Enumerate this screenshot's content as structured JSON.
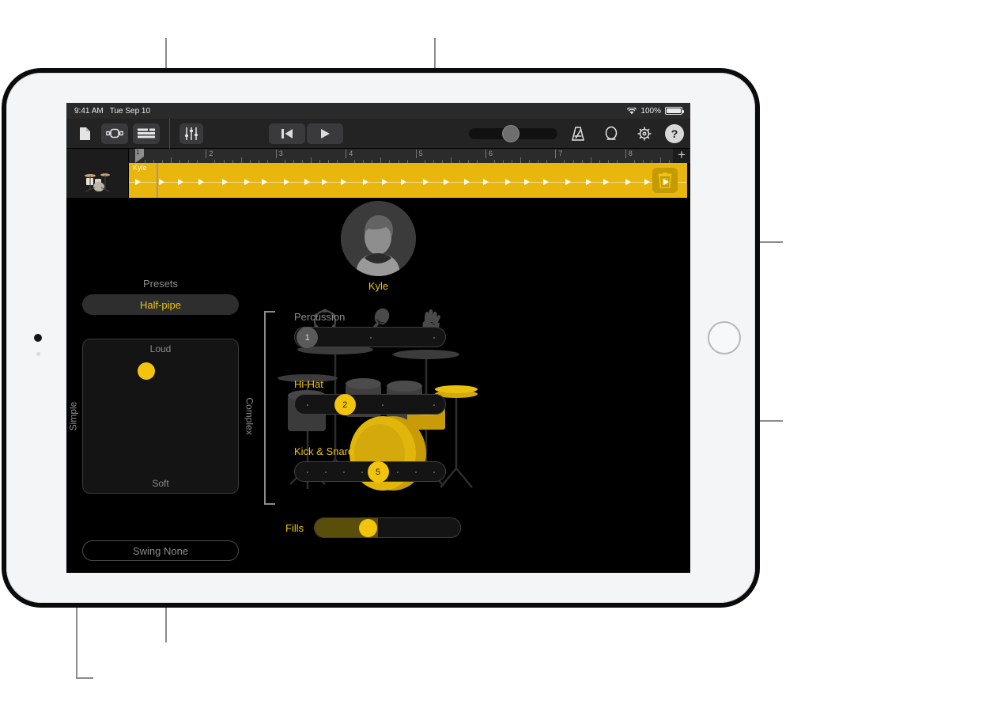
{
  "status_bar": {
    "time": "9:41 AM",
    "date": "Tue Sep 10",
    "battery_percent": "100%",
    "wifi_icon": "wifi-icon",
    "battery_icon": "battery-icon"
  },
  "toolbar": {
    "items": [
      {
        "name": "document-icon",
        "label": ""
      },
      {
        "name": "loop-browser-icon",
        "label": ""
      },
      {
        "name": "track-view-icon",
        "label": ""
      },
      {
        "name": "mixer-icon",
        "label": ""
      }
    ],
    "transport": {
      "rewind_label": "rewind-to-start-icon",
      "play_label": "play-icon"
    },
    "master_volume": {
      "name": "master-volume-slider",
      "value": 40
    },
    "right_icons": [
      {
        "name": "metronome-icon"
      },
      {
        "name": "loop-cycle-icon"
      },
      {
        "name": "settings-gear-icon"
      }
    ],
    "help_label": "?"
  },
  "ruler": {
    "bars": [
      "1",
      "2",
      "3",
      "4",
      "5",
      "6",
      "7",
      "8"
    ],
    "playhead_bar": "1",
    "add_track_label": "+"
  },
  "track": {
    "instrument_icon": "drum-kit-icon",
    "region_name": "Kyle",
    "delete_label": "trash-icon",
    "region_color": "#e8b60d"
  },
  "drummer": {
    "presets_label": "Presets",
    "preset_value": "Half-pipe",
    "swing_value": "Swing None",
    "xy_pad": {
      "top_label": "Loud",
      "bottom_label": "Soft",
      "left_label": "Simple",
      "right_label": "Complex",
      "puck_name": "xy-pad-puck"
    },
    "avatar": {
      "name": "Kyle",
      "image_name": "drummer-avatar"
    },
    "percussion_icons": [
      {
        "name": "tambourine-icon"
      },
      {
        "name": "shaker-icon"
      },
      {
        "name": "hand-clap-icon"
      }
    ],
    "fills": {
      "label": "Fills",
      "value": 30
    },
    "sliders": [
      {
        "name": "percussion-slider",
        "label": "Percussion",
        "value": "1",
        "active": false,
        "position_percent": 8,
        "dots": [
          50,
          92
        ]
      },
      {
        "name": "hi-hat-slider",
        "label": "Hi-Hat",
        "value": "2",
        "active": true,
        "position_percent": 33,
        "dots": [
          8,
          58,
          92
        ]
      },
      {
        "name": "kick-snare-slider",
        "label": "Kick & Snare",
        "value": "5",
        "active": true,
        "position_percent": 55,
        "dots": [
          8,
          20,
          32,
          44,
          68,
          80,
          92
        ]
      }
    ]
  },
  "colors": {
    "accent_yellow": "#f2c40c",
    "region_yellow": "#e8b60d",
    "label_gray": "#8c8c8c",
    "panel_black": "#000000"
  }
}
